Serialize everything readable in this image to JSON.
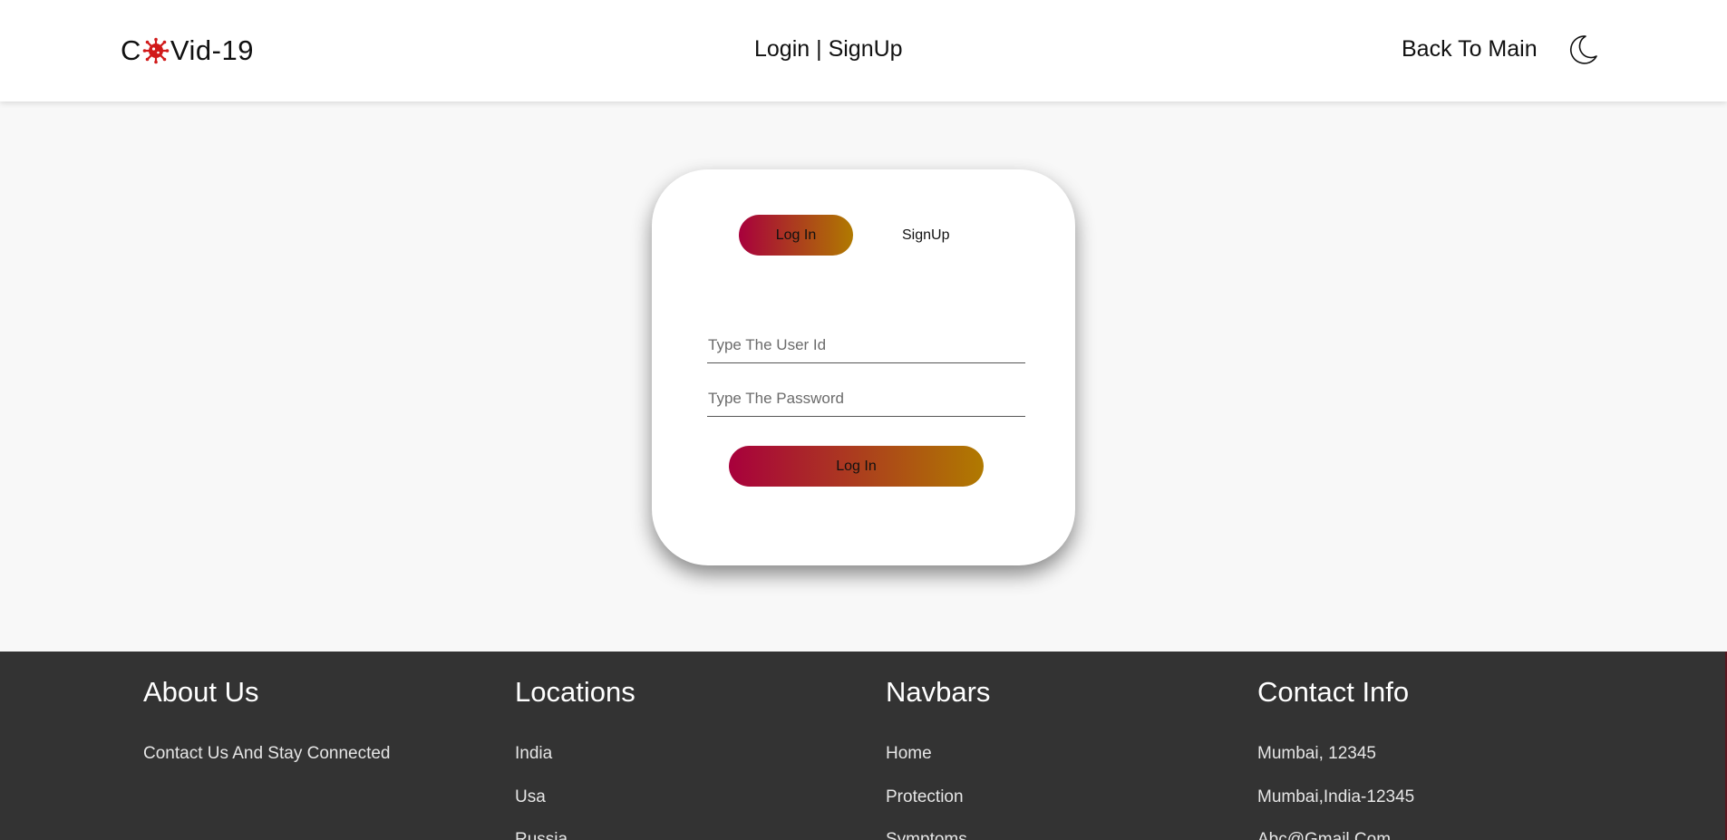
{
  "header": {
    "logo_prefix": "C",
    "logo_suffix": "Vid-19",
    "logo_icon": "virus-icon",
    "nav_login": "Login",
    "nav_separator": "|",
    "nav_signup": "SignUp",
    "back_to_main": "Back To Main",
    "theme_icon": "moon-icon"
  },
  "card": {
    "tab_login": "Log In",
    "tab_signup": "SignUp",
    "user_placeholder": "Type The User Id",
    "password_placeholder": "Type The Password",
    "submit_label": "Log In",
    "gradient_start": "#a8003c",
    "gradient_end": "#b07a00"
  },
  "footer": {
    "about": {
      "title": "About Us",
      "items": [
        "Contact Us And Stay Connected"
      ]
    },
    "locations": {
      "title": "Locations",
      "items": [
        "India",
        "Usa",
        "Russia"
      ]
    },
    "navbars": {
      "title": "Navbars",
      "items": [
        "Home",
        "Protection",
        "Symptoms"
      ]
    },
    "contact": {
      "title": "Contact Info",
      "items": [
        "Mumbai, 12345",
        "Mumbai,India-12345",
        "Abc@Gmail.Com"
      ]
    },
    "background": "#333333"
  }
}
